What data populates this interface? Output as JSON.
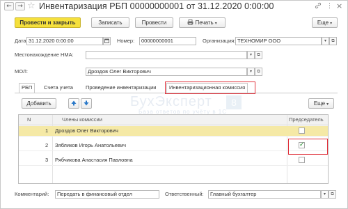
{
  "title": "Инвентаризация РБП 00000000001 от 31.12.2020 0:00:00",
  "nav": {
    "back": "←",
    "forward": "→",
    "star": "☆"
  },
  "window_icons": {
    "link": "🔗",
    "more": "⋮",
    "close": "×"
  },
  "toolbar": {
    "post_close": "Провести и закрыть",
    "save": "Записать",
    "post": "Провести",
    "print": "Печать",
    "more": "Еще"
  },
  "fields": {
    "date_label": "Дата:",
    "date_value": "31.12.2020  0:00:00",
    "number_label": "Номер:",
    "number_value": "00000000001",
    "org_label": "Организация:",
    "org_value": "ТЕХНОМИР ООО",
    "location_label": "Местонахождение НМА:",
    "location_value": "",
    "mol_label": "МОЛ:",
    "mol_value": "Дроздов Олег Викторович"
  },
  "tabs": [
    {
      "label": "РБП"
    },
    {
      "label": "Счета учета"
    },
    {
      "label": "Проведение инвентаризации"
    },
    {
      "label": "Инвентаризационная комиссия"
    }
  ],
  "table_toolbar": {
    "add": "Добавить",
    "more": "Еще"
  },
  "table": {
    "columns": [
      "N",
      "Члены комиссии",
      "Председатель"
    ],
    "rows": [
      {
        "n": "1",
        "name": "Дроздов Олег Викторович",
        "chair": false
      },
      {
        "n": "2",
        "name": "Зябликов Игорь Анатольевич",
        "chair": true
      },
      {
        "n": "3",
        "name": "Рябчикова Анастасия Павловна",
        "chair": false
      }
    ]
  },
  "watermark": {
    "line1": "БухЭксперт",
    "line2": "База ответов по учёту в 1С",
    "badge": "8"
  },
  "footer": {
    "comment_label": "Комментарий:",
    "comment_value": "Передать в финансовый отдел",
    "responsible_label": "Ответственный:",
    "responsible_value": "Главный бухгалтер"
  },
  "colors": {
    "primary_button": "#f5e03c",
    "selected_row": "#f5e9a6",
    "highlight": "#e0303a",
    "check": "#1f8a2a"
  }
}
